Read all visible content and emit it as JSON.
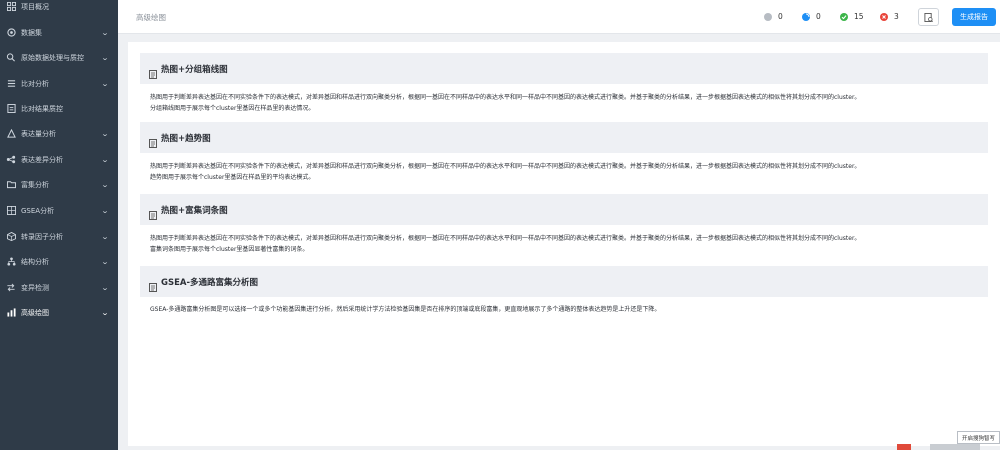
{
  "sidebar": {
    "items": [
      {
        "label": "项目概况",
        "icon": "grid-icon",
        "chevron": false
      },
      {
        "label": "数据集",
        "icon": "database-icon",
        "chevron": true
      },
      {
        "label": "原始数据处理与质控",
        "icon": "magnify-gear-icon",
        "chevron": true
      },
      {
        "label": "比对分析",
        "icon": "list-icon",
        "chevron": true
      },
      {
        "label": "比对结果质控",
        "icon": "document-check-icon",
        "chevron": false
      },
      {
        "label": "表达量分析",
        "icon": "triangle-chart-icon",
        "chevron": true
      },
      {
        "label": "表达差异分析",
        "icon": "nodes-icon",
        "chevron": true
      },
      {
        "label": "富集分析",
        "icon": "folder-icon",
        "chevron": true
      },
      {
        "label": "GSEA分析",
        "icon": "grid-small-icon",
        "chevron": true
      },
      {
        "label": "转录因子分析",
        "icon": "cube-icon",
        "chevron": true
      },
      {
        "label": "结构分析",
        "icon": "tree-icon",
        "chevron": true
      },
      {
        "label": "变异检测",
        "icon": "arrows-icon",
        "chevron": true
      },
      {
        "label": "高级绘图",
        "icon": "chart-icon",
        "chevron": true
      }
    ]
  },
  "header": {
    "breadcrumb": "高级绘图",
    "stats": [
      {
        "value": "0",
        "color": "#b7bcc3",
        "icon": "pending-icon"
      },
      {
        "value": "0",
        "color": "#1e8ff5",
        "icon": "running-icon"
      },
      {
        "value": "15",
        "color": "#3cb54a",
        "icon": "success-icon"
      },
      {
        "value": "3",
        "color": "#e8443a",
        "icon": "failed-icon"
      }
    ],
    "generate_label": "生成报告"
  },
  "sections": [
    {
      "title": "热图+分组箱线图",
      "lines": [
        "热图用于判断差异表达基因在不同实验条件下的表达模式，对差异基因和样品进行双向聚类分析，根据同一基因在不同样品中的表达水平和同一样品中不同基因的表达模式进行聚类。并基于聚类的分析结果，进一步根据基因表达模式的相似性将其划分成不同的cluster。",
        "分组箱线图用于展示每个cluster里基因在样品里的表达情况。"
      ]
    },
    {
      "title": "热图+趋势图",
      "lines": [
        "热图用于判断差异表达基因在不同实验条件下的表达模式，对差异基因和样品进行双向聚类分析，根据同一基因在不同样品中的表达水平和同一样品中不同基因的表达模式进行聚类。并基于聚类的分析结果，进一步根据基因表达模式的相似性将其划分成不同的cluster。",
        "趋势图用于展示每个cluster里基因在样品里的平均表达模式。"
      ]
    },
    {
      "title": "热图+富集词条图",
      "lines": [
        "热图用于判断差异表达基因在不同实验条件下的表达模式，对差异基因和样品进行双向聚类分析，根据同一基因在不同样品中的表达水平和同一样品中不同基因的表达模式进行聚类。并基于聚类的分析结果，进一步根据基因表达模式的相似性将其划分成不同的cluster。",
        "富集词条图用于展示每个cluster里基因显著性富集的词条。"
      ]
    },
    {
      "title": "GSEA-多通路富集分析图",
      "lines": [
        "GSEA-多通路富集分析图是可以选择一个或多个功能基因集进行分析，然后采用统计学方法检验基因集是否在排序的顶端或底段富集，更直观地展示了多个通路的整体表达趋势是上升还是下降。"
      ]
    }
  ],
  "tooltip": "开启搜狗智写"
}
